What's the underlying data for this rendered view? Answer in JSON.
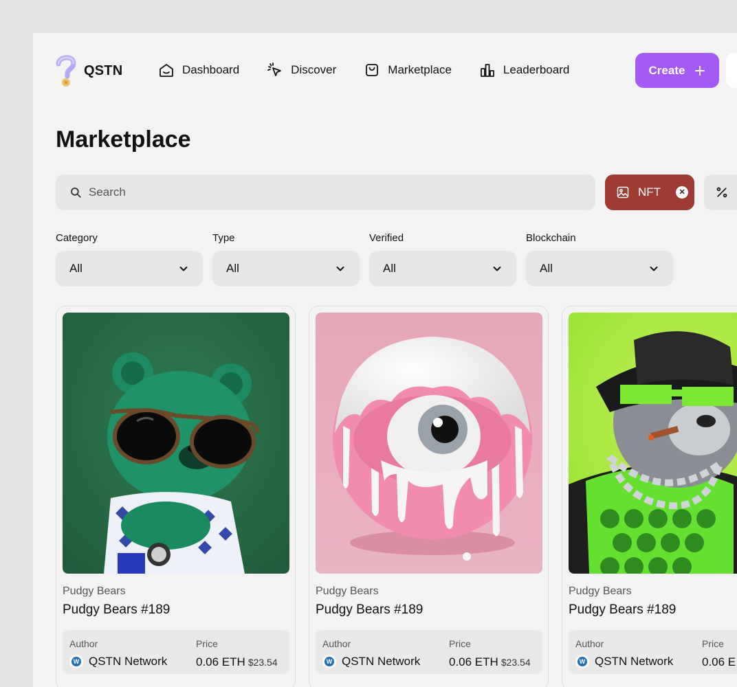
{
  "app": {
    "name": "QSTN"
  },
  "nav": [
    {
      "label": "Dashboard",
      "icon": "home-icon"
    },
    {
      "label": "Discover",
      "icon": "cursor-click-icon"
    },
    {
      "label": "Marketplace",
      "icon": "shopping-bag-icon"
    },
    {
      "label": "Leaderboard",
      "icon": "bar-chart-icon"
    }
  ],
  "header": {
    "create_label": "Create",
    "accent": "#a45bf6"
  },
  "page": {
    "title": "Marketplace"
  },
  "search": {
    "placeholder": "Search",
    "value": ""
  },
  "chips": [
    {
      "label": "NFT",
      "icon": "image-icon",
      "active": true,
      "color": "#9e3b33"
    },
    {
      "label": "",
      "icon": "percent-icon",
      "active": false
    }
  ],
  "filters": [
    {
      "label": "Category",
      "value": "All"
    },
    {
      "label": "Type",
      "value": "All"
    },
    {
      "label": "Verified",
      "value": "All"
    },
    {
      "label": "Blockchain",
      "value": "All"
    }
  ],
  "cards": [
    {
      "collection": "Pudgy Bears",
      "name": "Pudgy Bears #189",
      "author_label": "Author",
      "author": "QSTN Network",
      "price_label": "Price",
      "price": "0.06 ETH",
      "usd": "$23.54",
      "art": "green-bear-sunglasses"
    },
    {
      "collection": "Pudgy Bears",
      "name": "Pudgy Bears #189",
      "author_label": "Author",
      "author": "QSTN Network",
      "price_label": "Price",
      "price": "0.06 ETH",
      "usd": "$23.54",
      "art": "pink-dripping-eyeball"
    },
    {
      "collection": "Pudgy Bears",
      "name": "Pudgy Bears #189",
      "author_label": "Author",
      "author": "QSTN Network",
      "price_label": "Price",
      "price": "0.06 E",
      "usd": "",
      "art": "panda-hat-chain-cigar"
    }
  ]
}
